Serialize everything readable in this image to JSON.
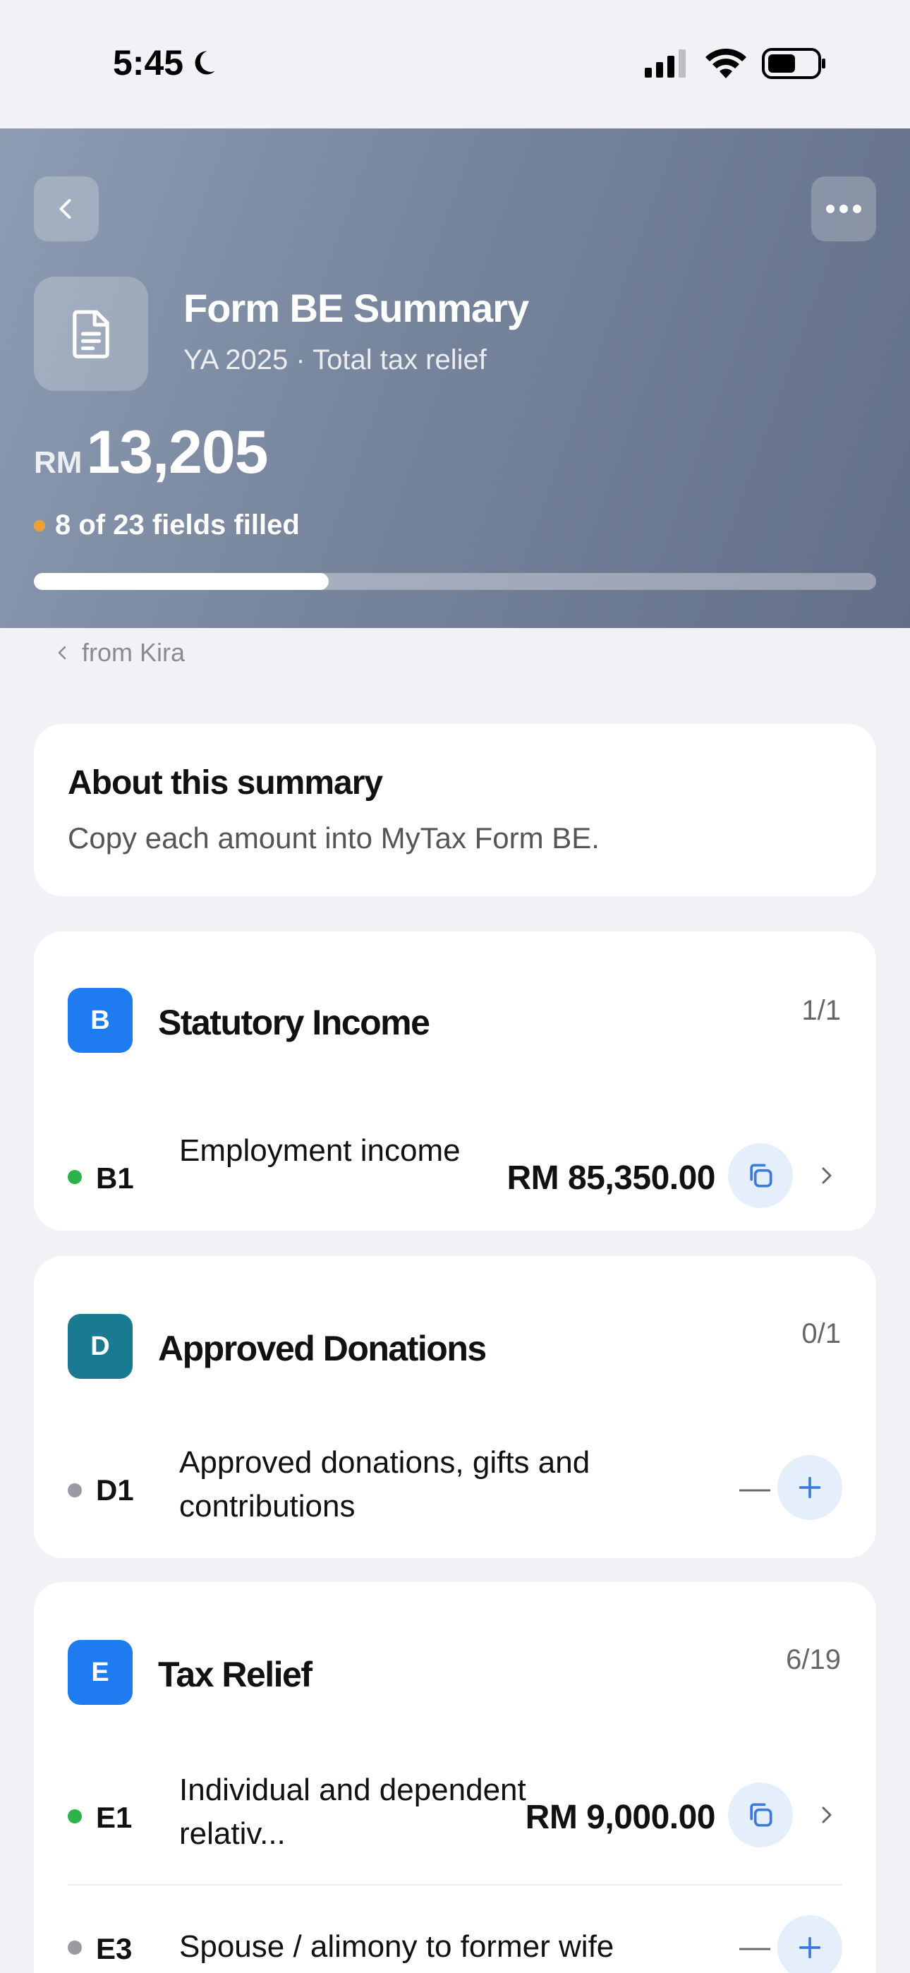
{
  "status_bar": {
    "time": "5:45"
  },
  "header": {
    "title": "Form BE Summary",
    "subtitle": "YA 2025 · Total tax relief",
    "currency": "RM",
    "total": "13,205",
    "fields_filled": "8 of 23 fields filled",
    "progress": 0.35
  },
  "breadcrumb": {
    "label": "from Kira"
  },
  "about": {
    "title": "About this summary",
    "text": "Copy each amount into MyTax Form BE."
  },
  "sections": [
    {
      "badge": "B",
      "title": "Statutory Income",
      "count": "1/1",
      "color": "#1e7cf0",
      "rows": [
        {
          "code": "B1",
          "label": "Employment income",
          "amount": "RM 85,350.00",
          "status_color": "#2bb34a"
        }
      ]
    },
    {
      "badge": "D",
      "title": "Approved Donations",
      "count": "0/1",
      "color": "#1a7a92",
      "rows": [
        {
          "code": "D1",
          "label": "Approved donations, gifts and contributions",
          "dash": "—",
          "status_color": "#9a9aa2"
        }
      ]
    },
    {
      "badge": "E",
      "title": "Tax Relief",
      "count": "6/19",
      "color": "#1e7cf0",
      "rows": [
        {
          "code": "E1",
          "label": "Individual and dependent relativ...",
          "amount": "RM 9,000.00",
          "status_color": "#2bb34a"
        },
        {
          "code": "E3",
          "label": "Spouse / alimony to former wife",
          "dash": "—",
          "status_color": "#9a9aa2"
        }
      ]
    }
  ]
}
